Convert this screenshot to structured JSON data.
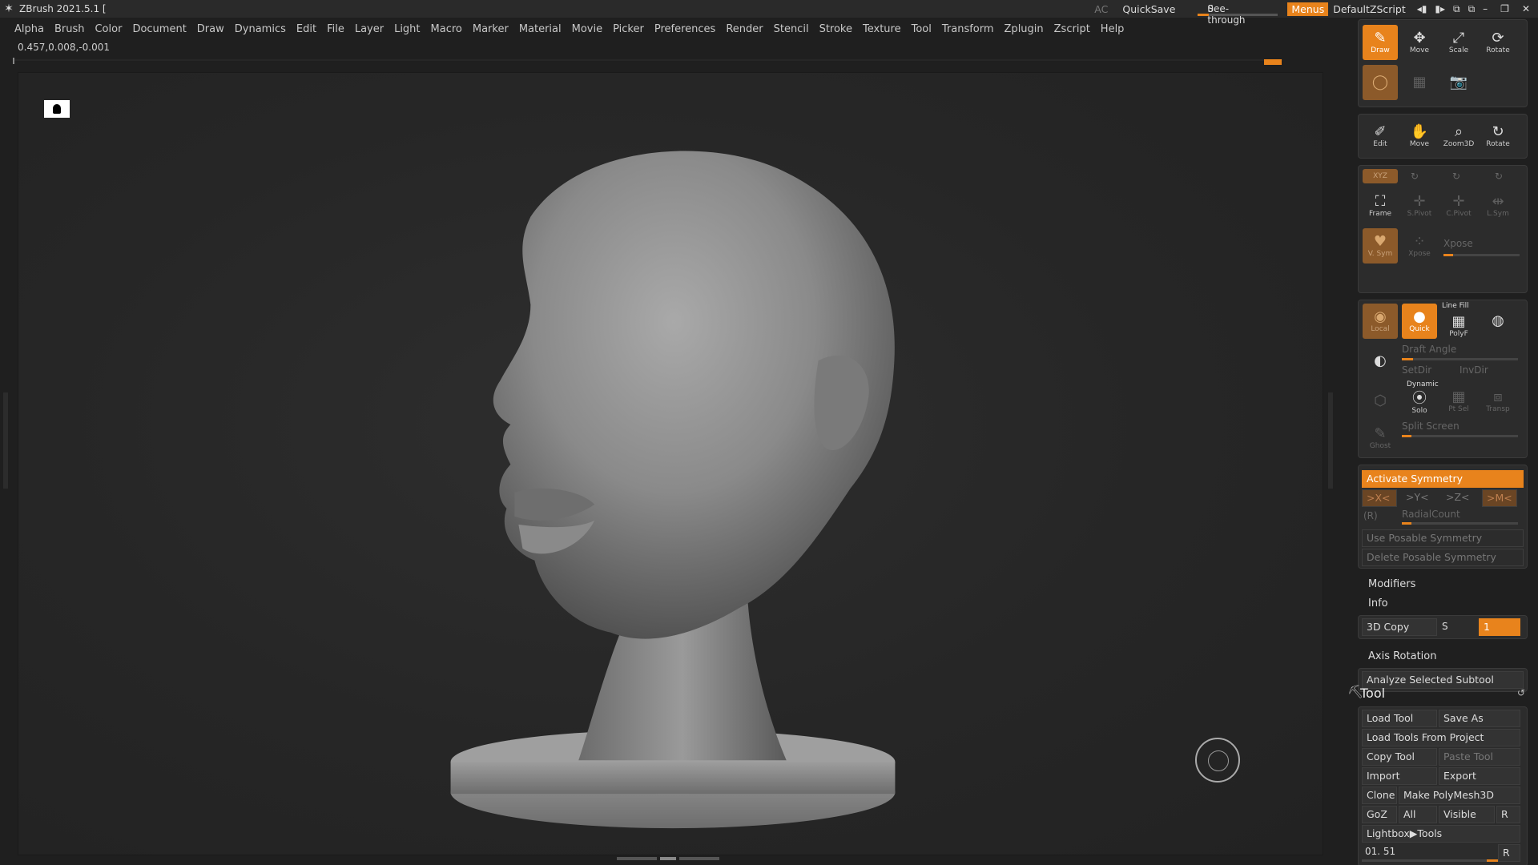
{
  "titlebar": {
    "app_title": "ZBrush 2021.5.1 [",
    "ac": "AC",
    "quicksave": "QuickSave",
    "see_through_label": "See-through",
    "see_through_value": "0",
    "menus": "Menus",
    "default_zscript": "DefaultZScript"
  },
  "menubar": [
    "Alpha",
    "Brush",
    "Color",
    "Document",
    "Draw",
    "Dynamics",
    "Edit",
    "File",
    "Layer",
    "Light",
    "Macro",
    "Marker",
    "Material",
    "Movie",
    "Picker",
    "Preferences",
    "Render",
    "Stencil",
    "Stroke",
    "Texture",
    "Tool",
    "Transform",
    "Zplugin",
    "Zscript",
    "Help"
  ],
  "coords": "0.457,0.008,-0.001",
  "shelf": {
    "draw": "Draw",
    "move": "Move",
    "scale": "Scale",
    "rotate": "Rotate",
    "edit": "Edit",
    "move2": "Move",
    "zoom3d": "Zoom3D",
    "rotate2": "Rotate",
    "frame": "Frame",
    "spivot": "S.Pivot",
    "cpivot": "C.Pivot",
    "lsym": "L.Sym",
    "vsym": "V. Sym",
    "xpose": "Xpose",
    "xpose_label": "Xpose",
    "local": "Local",
    "quick": "Quick",
    "line_fill": "Line Fill",
    "polyf": "PolyF",
    "draft_angle": "Draft Angle",
    "setdir": "SetDir",
    "invdir": "InvDir",
    "dynamic": "Dynamic",
    "solo": "Solo",
    "ptsel": "Pt Sel",
    "transp": "Transp",
    "split_screen": "Split Screen",
    "ghost": "Ghost",
    "xyz": "XYZ"
  },
  "symmetry": {
    "activate": "Activate Symmetry",
    "x": ">X<",
    "y": ">Y<",
    "z": ">Z<",
    "m": ">M<",
    "r": "(R)",
    "radial_count": "RadialCount",
    "use_posable": "Use Posable Symmetry",
    "delete_posable": "Delete Posable Symmetry"
  },
  "sections": {
    "modifiers": "Modifiers",
    "info": "Info",
    "copy3d": "3D Copy",
    "s": "S",
    "s_value": "1",
    "axis_rotation": "Axis Rotation",
    "analyze": "Analyze Selected Subtool"
  },
  "tool": {
    "title": "Tool",
    "load_tool": "Load Tool",
    "save_as": "Save As",
    "load_from_project": "Load Tools From Project",
    "copy_tool": "Copy Tool",
    "paste_tool": "Paste Tool",
    "import": "Import",
    "export": "Export",
    "clone": "Clone",
    "make_polymesh": "Make PolyMesh3D",
    "goz": "GoZ",
    "all": "All",
    "visible": "Visible",
    "r": "R",
    "lightbox_tools": "Lightbox▶Tools",
    "current": "01. 51",
    "r2": "R"
  },
  "colors": {
    "accent": "#e8831c",
    "panel": "#2c2c2c",
    "bg": "#1f1f1f"
  }
}
